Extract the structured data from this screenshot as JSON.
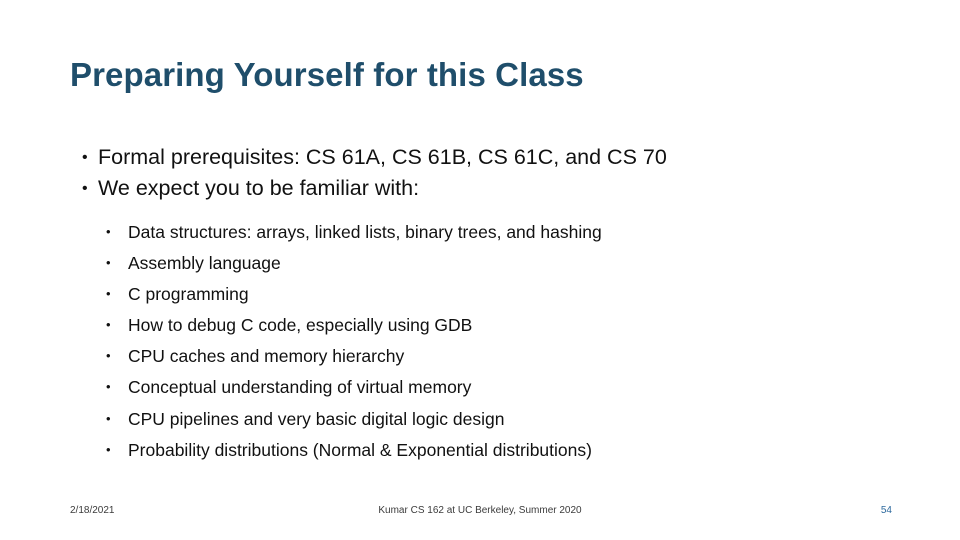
{
  "slide": {
    "title": "Preparing Yourself for this Class",
    "level1_bullets": [
      "Formal prerequisites: CS 61A, CS 61B, CS 61C, and CS 70",
      "We expect you to be familiar with:"
    ],
    "level2_bullets": [
      "Data structures: arrays, linked lists, binary trees, and hashing",
      "Assembly language",
      "C programming",
      "How to debug C code, especially using GDB",
      "CPU caches and memory hierarchy",
      "Conceptual understanding of virtual memory",
      "CPU pipelines and very basic digital logic design",
      "Probability distributions (Normal & Exponential distributions)"
    ],
    "bullet_glyph_level1": "•",
    "bullet_glyph_level2": "•",
    "footer": {
      "date": "2/18/2021",
      "center": "Kumar CS 162 at UC Berkeley, Summer 2020",
      "page_number": "54"
    },
    "colors": {
      "title": "#1F4E6B",
      "page_number": "#2E6A9E",
      "body": "#111111"
    }
  }
}
